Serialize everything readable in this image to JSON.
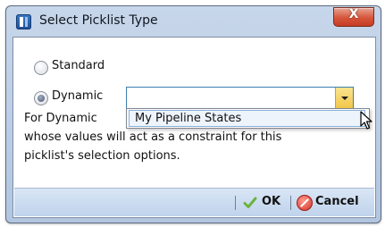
{
  "window": {
    "title": "Select Picklist Type",
    "close_glyph": "X"
  },
  "options": {
    "standard_label": "Standard",
    "dynamic_label": "Dynamic",
    "standard_selected": false,
    "dynamic_selected": true
  },
  "combo": {
    "value": "",
    "items": [
      "My Pipeline States"
    ]
  },
  "description": {
    "line1": "For Dynamic",
    "line2": "whose values will act as a constraint for this",
    "line3": "picklist's selection options."
  },
  "footer": {
    "ok_label": "OK",
    "cancel_label": "Cancel",
    "ok_icon": "checkmark-icon",
    "cancel_icon": "cancel-icon"
  },
  "colors": {
    "accent_dropdown_button": "#f0c545",
    "close_button": "#d6553b",
    "ok_check": "#6cb33f",
    "cancel_red": "#d2342b"
  }
}
